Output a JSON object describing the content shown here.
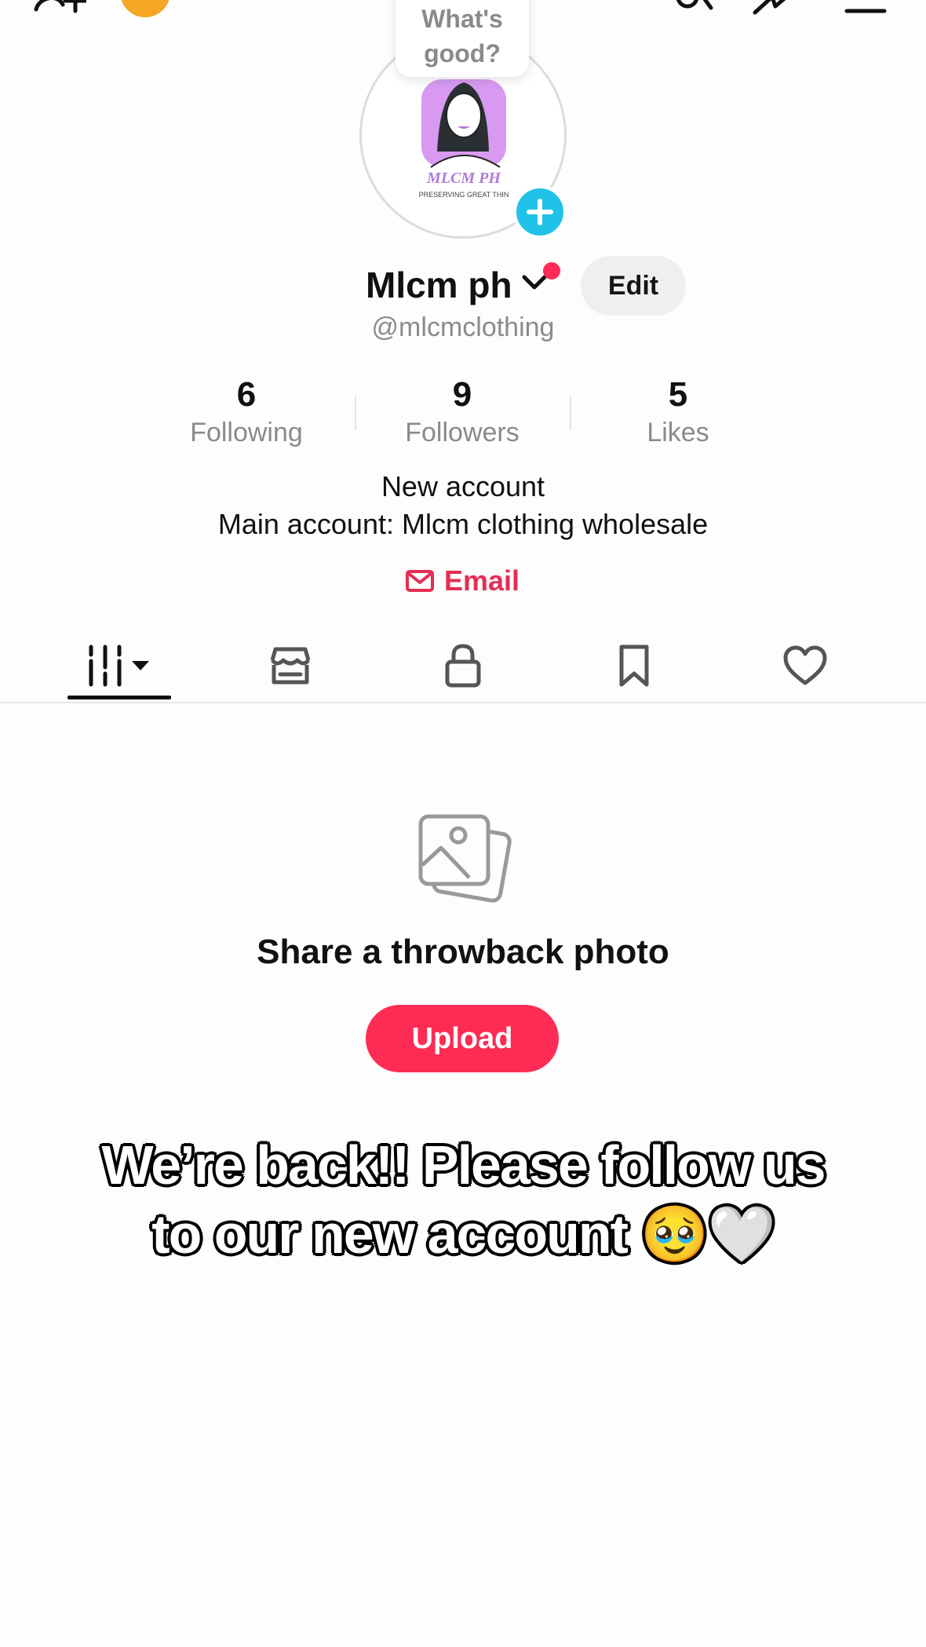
{
  "profile": {
    "bubble_line1": "What's",
    "bubble_line2": "good?",
    "avatar_brand": "MLCM PH",
    "avatar_tagline": "PRESERVING GREAT THIN",
    "name": "Mlcm ph",
    "edit_label": "Edit",
    "handle": "@mlcmclothing"
  },
  "stats": [
    {
      "value": "6",
      "label": "Following"
    },
    {
      "value": "9",
      "label": "Followers"
    },
    {
      "value": "5",
      "label": "Likes"
    }
  ],
  "bio": {
    "line1": "New account",
    "line2": "Main account: Mlcm clothing wholesale"
  },
  "email_label": "Email",
  "tabs": [
    {
      "icon": "videos-grid-icon",
      "active": true
    },
    {
      "icon": "shop-icon",
      "active": false
    },
    {
      "icon": "lock-icon",
      "active": false
    },
    {
      "icon": "bookmark-icon",
      "active": false
    },
    {
      "icon": "heart-icon",
      "active": false
    }
  ],
  "empty_state": {
    "icon": "photos-icon",
    "title": "Share a throwback photo",
    "upload_label": "Upload"
  },
  "overlay_text": {
    "line1": "We’re back!! Please follow us",
    "line2": "to our new account 🥹🤍"
  },
  "colors": {
    "accent": "#fe2c55",
    "avatar_add": "#20c3e8",
    "coin": "#f5a623",
    "muted": "#8a8a8a"
  }
}
